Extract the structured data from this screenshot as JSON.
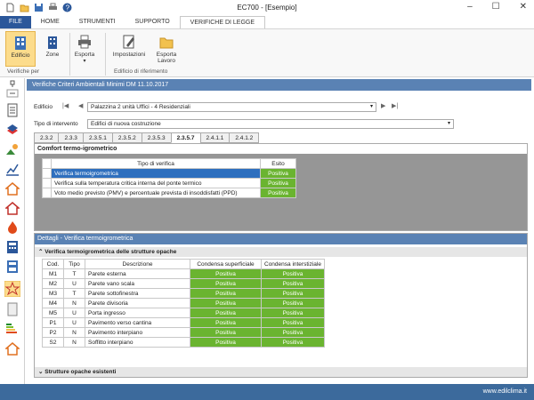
{
  "window": {
    "title": "EC700 - [Esempio]"
  },
  "tabs": [
    "FILE",
    "HOME",
    "STRUMENTI",
    "SUPPORTO",
    "VERIFICHE DI LEGGE"
  ],
  "ribbon": {
    "buttons": [
      "Edificio",
      "Zone",
      "Esporta",
      "Impostazioni",
      "Esporta Lavoro"
    ],
    "groups": [
      "Verifiche per",
      "Edificio di riferimento"
    ]
  },
  "panel": {
    "title": "Verifiche Criteri Ambientali Minimi DM 11.10.2017",
    "edificio_label": "Edificio",
    "edificio_value": "Palazzina 2 unità Uffici - 4 Residenziali",
    "tipo_label": "Tipo di intervento",
    "tipo_value": "Edifici di nuova costruzione",
    "subtabs": [
      "2.3.2",
      "2.3.3",
      "2.3.5.1",
      "2.3.5.2",
      "2.3.5.3",
      "2.3.5.7",
      "2.4.1.1",
      "2.4.1.2"
    ]
  },
  "comfort": {
    "title": "Comfort termo-igrometrico",
    "col_tipo": "Tipo di verifica",
    "col_esito": "Esito",
    "rows": [
      {
        "desc": "Verifica termoigrometrica",
        "esito": "Positiva"
      },
      {
        "desc": "Verifica sulla temperatura critica interna del ponte termico",
        "esito": "Positiva"
      },
      {
        "desc": "Voto medio previsto (PMV) e percentuale prevista di insoddisfatti (PPD)",
        "esito": "Positiva"
      }
    ]
  },
  "dettagli": {
    "title": "Dettagli - Verifica termoigrometrica",
    "section1": "Verifica termoigrometrica delle strutture opache",
    "section2": "Strutture opache esistenti",
    "headers": [
      "Cod.",
      "Tipo",
      "Descrizione",
      "Condensa superficiale",
      "Condensa interstiziale"
    ],
    "rows": [
      {
        "cod": "M1",
        "tipo": "T",
        "desc": "Parete esterna",
        "sup": "Positiva",
        "int": "Positiva"
      },
      {
        "cod": "M2",
        "tipo": "U",
        "desc": "Parete vano scala",
        "sup": "Positiva",
        "int": "Positiva"
      },
      {
        "cod": "M3",
        "tipo": "T",
        "desc": "Parete sottofinestra",
        "sup": "Positiva",
        "int": "Positiva"
      },
      {
        "cod": "M4",
        "tipo": "N",
        "desc": "Parete divisoria",
        "sup": "Positiva",
        "int": "Positiva"
      },
      {
        "cod": "M5",
        "tipo": "U",
        "desc": "Porta ingresso",
        "sup": "Positiva",
        "int": "Positiva"
      },
      {
        "cod": "P1",
        "tipo": "U",
        "desc": "Pavimento verso cantina",
        "sup": "Positiva",
        "int": "Positiva"
      },
      {
        "cod": "P2",
        "tipo": "N",
        "desc": "Pavimento interpiano",
        "sup": "Positiva",
        "int": "Positiva"
      },
      {
        "cod": "S2",
        "tipo": "N",
        "desc": "Soffitto interpiano",
        "sup": "Positiva",
        "int": "Positiva"
      }
    ]
  },
  "statusbar": {
    "text": "www.edilclima.it"
  },
  "colors": {
    "file_tab": "#2b579a",
    "header": "#5a82b4",
    "positive": "#6ab430",
    "selected": "#2e6fbe",
    "statusbar": "#3c6a9c"
  }
}
